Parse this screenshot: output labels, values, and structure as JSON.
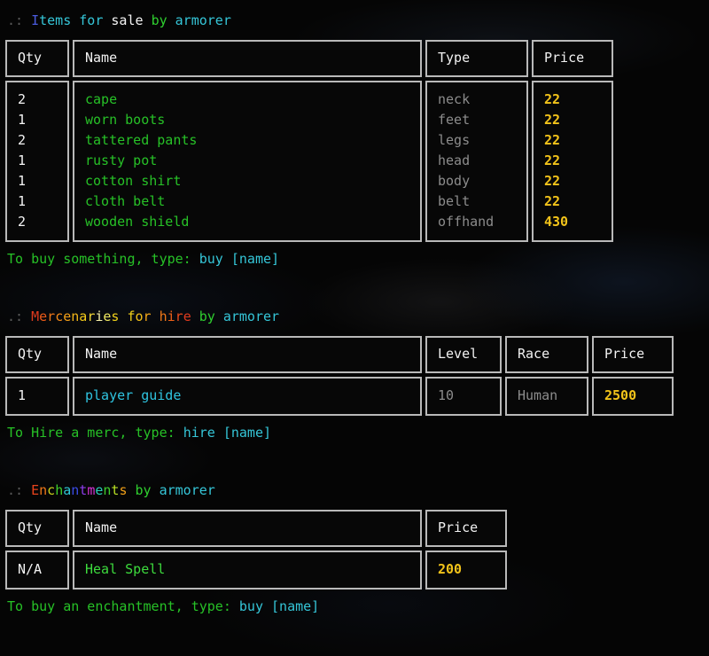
{
  "theme": {
    "background": "#050505",
    "border": "#b9b9b9",
    "text_white": "#f4f4f4",
    "text_grey": "#8c8c8c",
    "text_green": "#27c127",
    "text_cyan": "#35c6d8",
    "text_gold": "#f3c41a"
  },
  "sections": [
    {
      "id": "items",
      "title_prefix": ".:",
      "title_plain": ".: Items for sale by armorer",
      "title_parts": [
        {
          "text": ".: ",
          "color": "#5a5a5a"
        },
        {
          "text": "I",
          "color": "#4b5ce0"
        },
        {
          "text": "tems",
          "color": "#35c6d8"
        },
        {
          "text": " ",
          "color": "transparent"
        },
        {
          "text": "for",
          "color": "#35c6d8"
        },
        {
          "text": " ",
          "color": "transparent"
        },
        {
          "text": "sale",
          "color": "#f4f4f4"
        },
        {
          "text": " ",
          "color": "transparent"
        },
        {
          "text": "by",
          "color": "#2fcf2f"
        },
        {
          "text": " ",
          "color": "transparent"
        },
        {
          "text": "armorer",
          "color": "#35c6d8"
        }
      ],
      "columns": [
        "Qty",
        "Name",
        "Type",
        "Price"
      ],
      "rows": [
        {
          "qty": "2",
          "name": "cape",
          "type": "neck",
          "price": "22"
        },
        {
          "qty": "1",
          "name": "worn boots",
          "type": "feet",
          "price": "22"
        },
        {
          "qty": "2",
          "name": "tattered pants",
          "type": "legs",
          "price": "22"
        },
        {
          "qty": "1",
          "name": "rusty pot",
          "type": "head",
          "price": "22"
        },
        {
          "qty": "1",
          "name": "cotton shirt",
          "type": "body",
          "price": "22"
        },
        {
          "qty": "1",
          "name": "cloth belt",
          "type": "belt",
          "price": "22"
        },
        {
          "qty": "2",
          "name": "wooden shield",
          "type": "offhand",
          "price": "430"
        }
      ],
      "hint_plain": "To buy something, type: buy [name]",
      "hint_parts": [
        {
          "text": "To buy something, type: ",
          "color": "#27c127"
        },
        {
          "text": "buy [name]",
          "color": "#35c6d8"
        }
      ]
    },
    {
      "id": "mercenaries",
      "title_plain": ".: Mercenaries for hire by armorer",
      "title_parts": [
        {
          "text": ".: ",
          "color": "#5a5a5a"
        },
        {
          "text": "M",
          "color": "#e03a1e"
        },
        {
          "text": "e",
          "color": "#ec5a18"
        },
        {
          "text": "r",
          "color": "#f07818"
        },
        {
          "text": "c",
          "color": "#f28a18"
        },
        {
          "text": "e",
          "color": "#f3a018"
        },
        {
          "text": "n",
          "color": "#f5b818"
        },
        {
          "text": "a",
          "color": "#f6cc1a"
        },
        {
          "text": "r",
          "color": "#f3d838"
        },
        {
          "text": "i",
          "color": "#f7f0a8"
        },
        {
          "text": "e",
          "color": "#f0e860"
        },
        {
          "text": "s",
          "color": "#f2d21a"
        },
        {
          "text": " ",
          "color": "transparent"
        },
        {
          "text": "f",
          "color": "#f2d21a"
        },
        {
          "text": "o",
          "color": "#f3c018"
        },
        {
          "text": "r",
          "color": "#f4a818"
        },
        {
          "text": " ",
          "color": "transparent"
        },
        {
          "text": "h",
          "color": "#f07818"
        },
        {
          "text": "i",
          "color": "#ec6018"
        },
        {
          "text": "r",
          "color": "#e84a1c"
        },
        {
          "text": "e",
          "color": "#e03a1e"
        },
        {
          "text": " ",
          "color": "transparent"
        },
        {
          "text": "by",
          "color": "#2fcf2f"
        },
        {
          "text": " ",
          "color": "transparent"
        },
        {
          "text": "armorer",
          "color": "#35c6d8"
        }
      ],
      "columns": [
        "Qty",
        "Name",
        "Level",
        "Race",
        "Price"
      ],
      "rows": [
        {
          "qty": "1",
          "name": "player guide",
          "level": "10",
          "race": "Human",
          "price": "2500"
        }
      ],
      "hint_plain": "To Hire a merc, type: hire [name]",
      "hint_parts": [
        {
          "text": "To Hire a merc, type: ",
          "color": "#27c127"
        },
        {
          "text": "hire [name]",
          "color": "#35c6d8"
        }
      ]
    },
    {
      "id": "enchantments",
      "title_plain": ".: Enchantments by armorer",
      "title_parts": [
        {
          "text": ".: ",
          "color": "#5a5a5a"
        },
        {
          "text": "E",
          "color": "#e8431c"
        },
        {
          "text": "n",
          "color": "#f07818"
        },
        {
          "text": "c",
          "color": "#c9d41c"
        },
        {
          "text": "h",
          "color": "#3ecf2c"
        },
        {
          "text": "a",
          "color": "#2ec8d8"
        },
        {
          "text": "n",
          "color": "#3a4ce8"
        },
        {
          "text": "t",
          "color": "#8b3ce8"
        },
        {
          "text": "m",
          "color": "#d433d4"
        },
        {
          "text": "e",
          "color": "#2ad0b8"
        },
        {
          "text": "n",
          "color": "#3ecf2c"
        },
        {
          "text": "t",
          "color": "#b8e024"
        },
        {
          "text": "s",
          "color": "#f0a018"
        },
        {
          "text": " ",
          "color": "transparent"
        },
        {
          "text": "by",
          "color": "#2fcf2f"
        },
        {
          "text": " ",
          "color": "transparent"
        },
        {
          "text": "armorer",
          "color": "#35c6d8"
        }
      ],
      "columns": [
        "Qty",
        "Name",
        "Price"
      ],
      "rows": [
        {
          "qty": "N/A",
          "name": "Heal Spell",
          "price": "200"
        }
      ],
      "hint_plain": "To buy an enchantment, type: buy [name]",
      "hint_parts": [
        {
          "text": "To buy an enchantment, type: ",
          "color": "#27c127"
        },
        {
          "text": "buy [name]",
          "color": "#35c6d8"
        }
      ]
    }
  ]
}
